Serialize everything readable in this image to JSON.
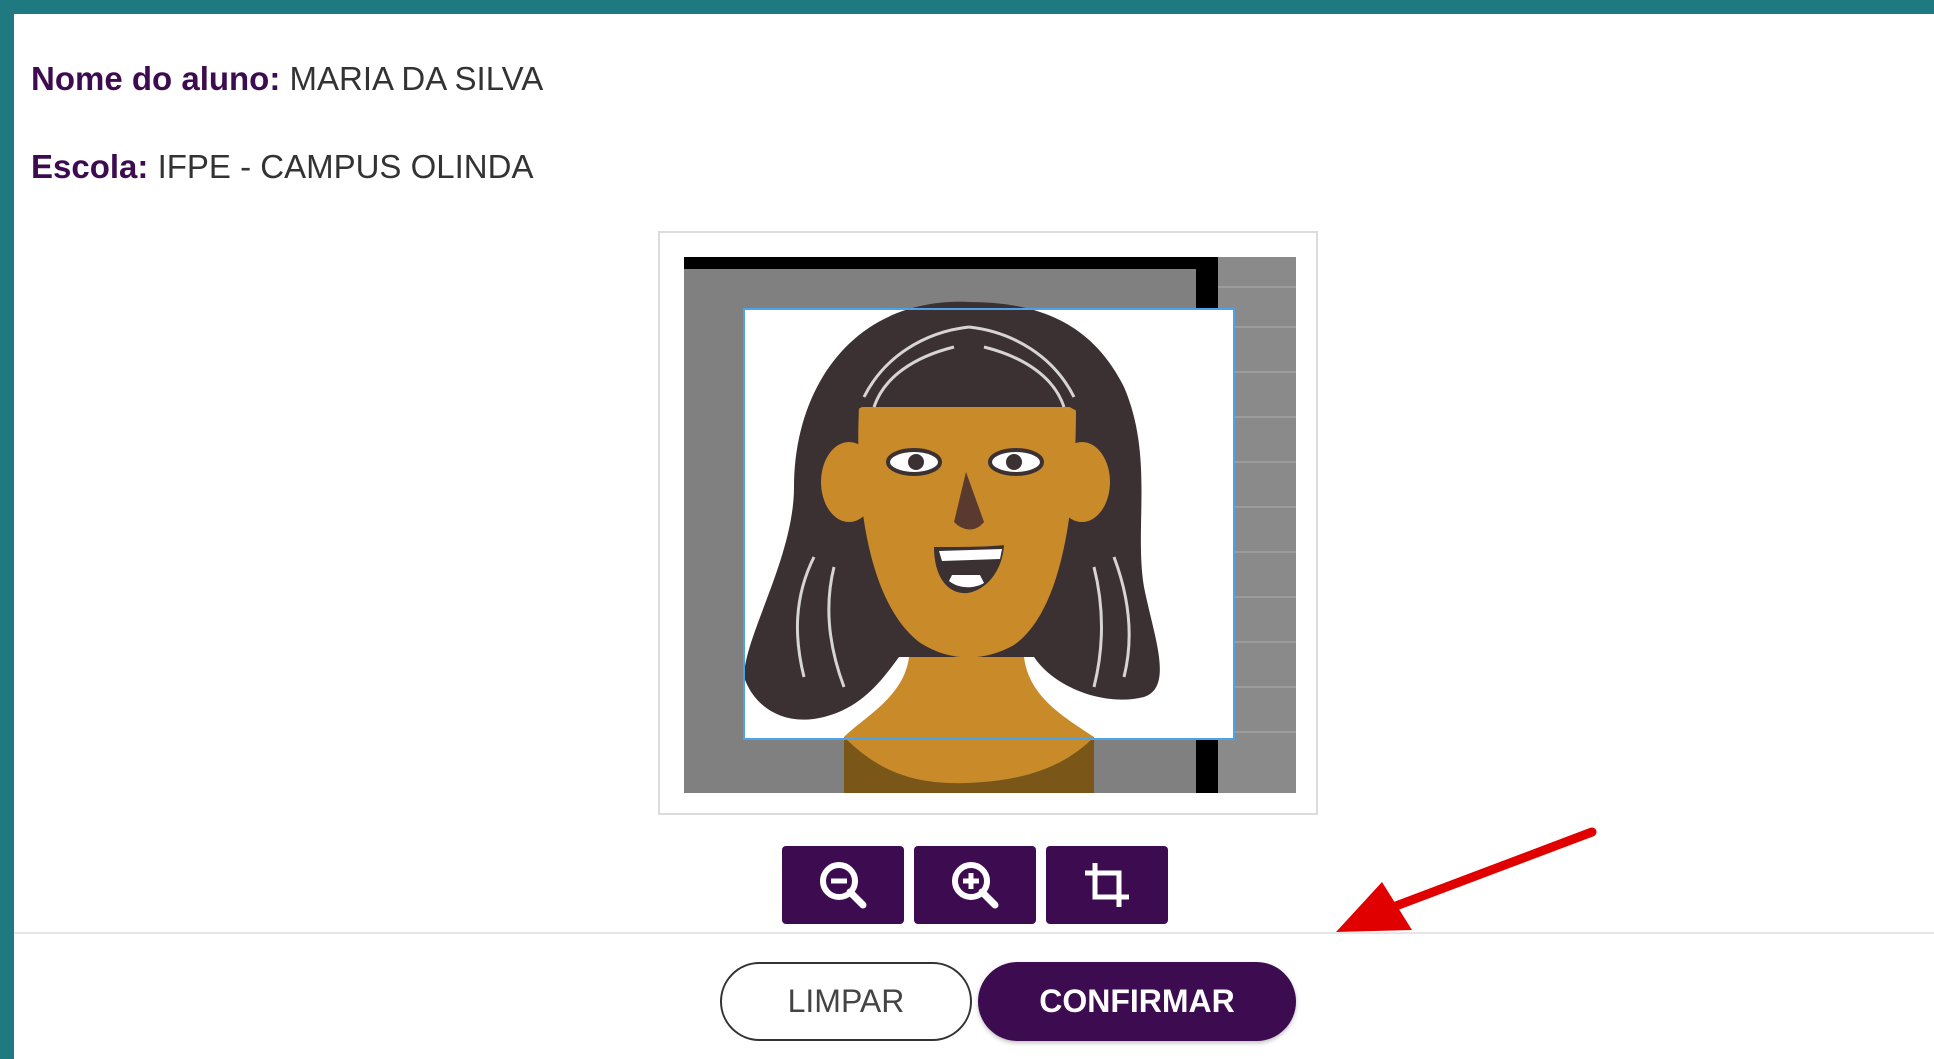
{
  "student": {
    "name_label": "Nome do aluno:",
    "name_value": "MARIA DA SILVA",
    "school_label": "Escola:",
    "school_value": "IFPE - CAMPUS OLINDA"
  },
  "tools": {
    "zoom_out_icon": "zoom-out-icon",
    "zoom_in_icon": "zoom-in-icon",
    "crop_icon": "crop-icon"
  },
  "actions": {
    "clear_label": "LIMPAR",
    "confirm_label": "CONFIRMAR"
  },
  "colors": {
    "frame": "#1e7a80",
    "brand": "#3d0b4f",
    "annotation_arrow": "#e00000",
    "crop_selection": "#4da3e8"
  }
}
